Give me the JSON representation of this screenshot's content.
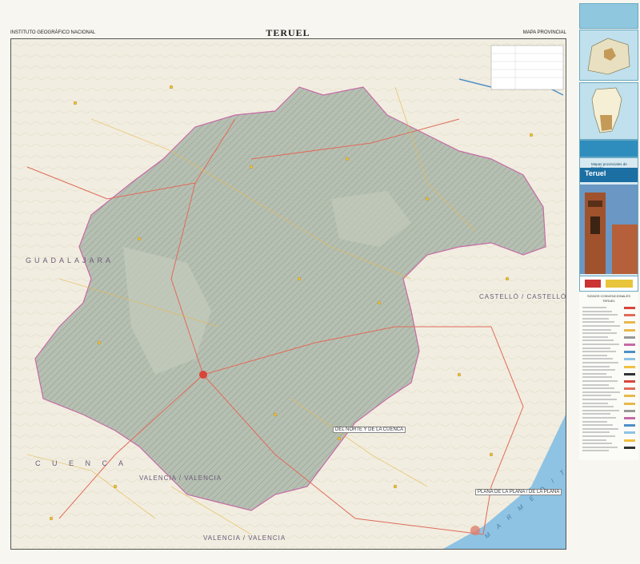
{
  "header": {
    "left": "INSTITUTO GEOGRÁFICO NACIONAL",
    "title": "TERUEL",
    "right": "MAPA PROVINCIAL"
  },
  "map": {
    "province_labels": [
      "GUADALAJARA",
      "CASTELLÓ / CASTELLÓN",
      "VALENCIA / VALENCIA",
      "VALENCIA / VALENCIA"
    ],
    "region_labels": [
      "C U E N C A"
    ],
    "sea_label": "M A R   M E D I T E R R Á N E O",
    "boxed_labels": [
      "PLANA DE LA PLANA / DE LA PLANA",
      "DEL NORTE Y DE LA CUENCA"
    ],
    "colors": {
      "province": "#b9c3b5",
      "outside": "#f1ede0",
      "sea": "#8ec3e3",
      "roads": "#e06b5a",
      "boundary": "#c56aa6"
    }
  },
  "sidebar": {
    "cover_title": "Teruel",
    "brand": "Mapas provinciales de España",
    "legend_title": "SIGNOS CONVENCIONALES",
    "legend_name": "TERUEL"
  }
}
